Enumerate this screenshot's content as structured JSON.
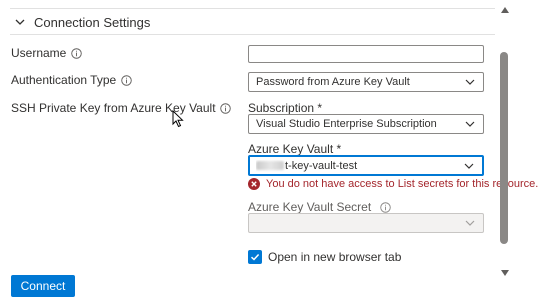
{
  "section": {
    "title": "Connection Settings",
    "expanded": true
  },
  "fields": {
    "username": {
      "label": "Username",
      "value": ""
    },
    "auth_type": {
      "label": "Authentication Type",
      "selected": "Password from Azure Key Vault"
    },
    "ssh_key": {
      "label": "SSH Private Key from Azure Key Vault"
    }
  },
  "subscription": {
    "label": "Subscription *",
    "selected": "Visual Studio Enterprise Subscription"
  },
  "key_vault": {
    "label": "Azure Key Vault *",
    "selected_visible": "t-key-vault-test",
    "error": "You do not have access to List secrets for this resource."
  },
  "key_vault_secret": {
    "label": "Azure Key Vault Secret",
    "selected": ""
  },
  "open_new_tab": {
    "label": "Open in new browser tab",
    "checked": true
  },
  "connect_button": {
    "label": "Connect"
  },
  "colors": {
    "accent": "#0078d4",
    "error": "#a4262c",
    "text": "#323130",
    "border": "#8a8886"
  },
  "icons": [
    "chevron-down-icon",
    "info-icon",
    "error-icon",
    "checkmark-icon",
    "pointer-cursor-icon"
  ]
}
